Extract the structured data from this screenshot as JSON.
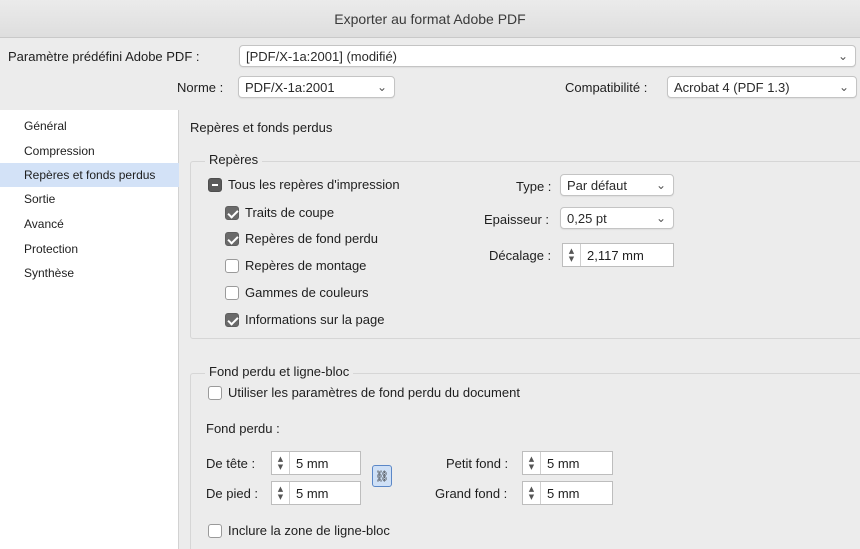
{
  "window": {
    "title": "Exporter au format Adobe PDF"
  },
  "header": {
    "preset_label": "Paramètre prédéfini Adobe PDF :",
    "preset_value": "[PDF/X-1a:2001] (modifié)",
    "standard_label": "Norme :",
    "standard_value": "PDF/X-1a:2001",
    "compat_label": "Compatibilité :",
    "compat_value": "Acrobat 4 (PDF 1.3)"
  },
  "sidebar": {
    "items": [
      {
        "label": "Général",
        "selected": false
      },
      {
        "label": "Compression",
        "selected": false
      },
      {
        "label": "Repères et fonds perdus",
        "selected": true
      },
      {
        "label": "Sortie",
        "selected": false
      },
      {
        "label": "Avancé",
        "selected": false
      },
      {
        "label": "Protection",
        "selected": false
      },
      {
        "label": "Synthèse",
        "selected": false
      }
    ]
  },
  "main": {
    "heading": "Repères et fonds perdus",
    "marks": {
      "title": "Repères",
      "all_marks": {
        "label": "Tous les repères d'impression",
        "state": "mixed"
      },
      "options": [
        {
          "label": "Traits de coupe",
          "checked": true
        },
        {
          "label": "Repères de fond perdu",
          "checked": true
        },
        {
          "label": "Repères de montage",
          "checked": false
        },
        {
          "label": "Gammes de couleurs",
          "checked": false
        },
        {
          "label": "Informations sur la page",
          "checked": true
        }
      ],
      "type_label": "Type :",
      "type_value": "Par défaut",
      "weight_label": "Epaisseur :",
      "weight_value": "0,25 pt",
      "offset_label": "Décalage :",
      "offset_value": "2,117 mm"
    },
    "bleed": {
      "title": "Fond perdu et ligne-bloc",
      "use_doc_label": "Utiliser les paramètres de fond perdu du document",
      "use_doc_checked": false,
      "bleed_label": "Fond perdu :",
      "top_label": "De tête :",
      "top_value": "5 mm",
      "bottom_label": "De pied :",
      "bottom_value": "5 mm",
      "inside_label": "Petit fond :",
      "inside_value": "5 mm",
      "outside_label": "Grand fond :",
      "outside_value": "5 mm",
      "slug_label": "Inclure la zone de ligne-bloc",
      "slug_checked": false
    }
  },
  "icons": {
    "chevron": "chevron-down-icon",
    "stepper": "stepper-icon",
    "link": "chain-link-icon"
  },
  "colors": {
    "selection": "#d3e2f7",
    "link_button": "#cfe0f6",
    "link_border": "#5b87c7"
  }
}
